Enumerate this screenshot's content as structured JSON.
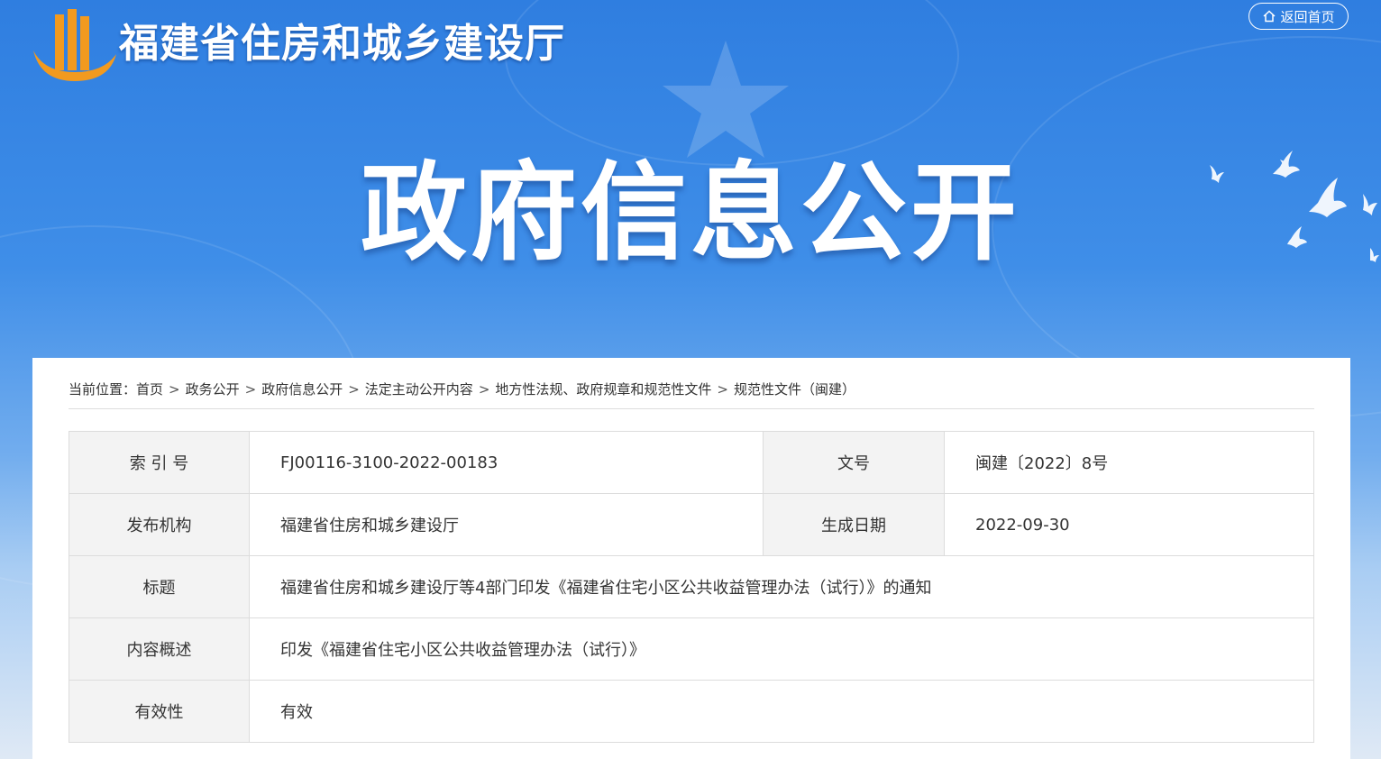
{
  "header": {
    "site_title": "福建省住房和城乡建设厅",
    "home_button": "返回首页",
    "banner_title": "政府信息公开"
  },
  "breadcrumb": {
    "prefix": "当前位置：",
    "items": [
      "首页",
      "政务公开",
      "政府信息公开",
      "法定主动公开内容",
      "地方性法规、政府规章和规范性文件",
      "规范性文件（闽建）"
    ],
    "separator": ">"
  },
  "meta": {
    "index_label": "索 引 号",
    "index_value": "FJ00116-3100-2022-00183",
    "doc_no_label": "文号",
    "doc_no_value": "闽建〔2022〕8号",
    "publisher_label": "发布机构",
    "publisher_value": "福建省住房和城乡建设厅",
    "date_label": "生成日期",
    "date_value": "2022-09-30",
    "title_label": "标题",
    "title_value": "福建省住房和城乡建设厅等4部门印发《福建省住宅小区公共收益管理办法（试行）》的通知",
    "summary_label": "内容概述",
    "summary_value": "印发《福建省住宅小区公共收益管理办法（试行）》",
    "validity_label": "有效性",
    "validity_value": "有效"
  },
  "colors": {
    "banner_top": "#2f7ee0",
    "banner_bottom": "#dfe9f5",
    "logo_orange": "#f29a1f",
    "table_key_bg": "#f3f3f3"
  },
  "icons": [
    "logo-icon",
    "home-icon",
    "star-emblem-icon",
    "dove-icon"
  ]
}
